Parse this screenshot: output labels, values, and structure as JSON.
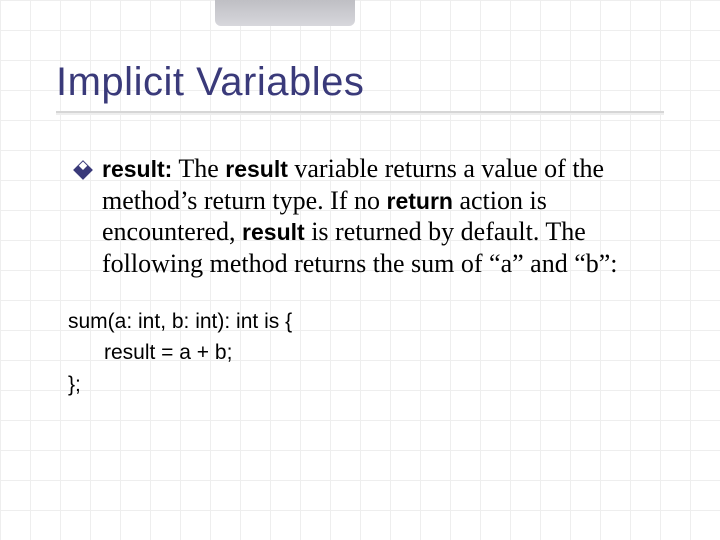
{
  "slide": {
    "title": "Implicit Variables",
    "bullet": {
      "lead_bold": "result:",
      "sp1": " ",
      "t1": "The ",
      "b2": "result",
      "t2": " variable returns a value of the method’s return type. If no ",
      "b3": "return",
      "t3": " action is encountered, ",
      "b4": "result",
      "t4": " is returned by default. The following method returns the sum of “a” and “b”:"
    },
    "code": {
      "l1": "sum(a: int, b: int): int is {",
      "l2": "result = a + b;",
      "l3": "};"
    }
  }
}
